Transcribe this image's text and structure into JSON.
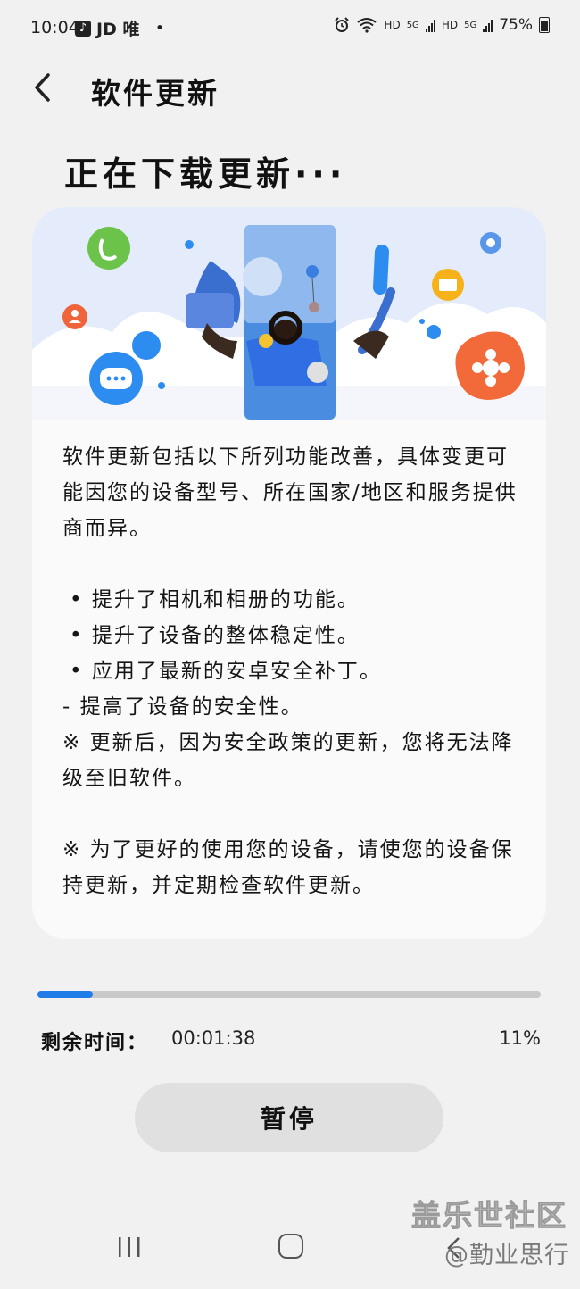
{
  "status_bar": {
    "time": "10:04",
    "left_text": "JD 唯",
    "dot": "•",
    "hd1": "HD",
    "net1": "5G",
    "hd2": "HD",
    "net2": "5G",
    "battery": "75%",
    "icons": [
      "app-icon",
      "alarm-icon",
      "wifi-icon",
      "signal-icon",
      "battery-icon"
    ]
  },
  "header": {
    "title": "软件更新",
    "back_icon": "chevron-left-icon"
  },
  "heading": "正在下载更新···",
  "card": {
    "intro": "软件更新包括以下所列功能改善，具体变更可能因您的设备型号、所在国家/地区和服务提供商而异。",
    "bullets": [
      "•  提升了相机和相册的功能。",
      "•  提升了设备的整体稳定性。",
      "•  应用了最新的安卓安全补丁。"
    ],
    "sub_item": "- 提高了设备的安全性。",
    "note1": "※ 更新后，因为安全政策的更新，您将无法降级至旧软件。",
    "note2": "※ 为了更好的使用您的设备，请使您的设备保持更新，并定期检查软件更新。"
  },
  "progress": {
    "fraction": 0.11,
    "color": "#1f7de8"
  },
  "remaining": {
    "label": "剩余时间：",
    "value": "00:01:38",
    "percent": "11%"
  },
  "pause_label": "暂停",
  "nav": {
    "icons": [
      "recent-apps-icon",
      "home-icon",
      "back-icon"
    ]
  },
  "watermark": {
    "line1": "盖乐世社区",
    "line2": "@勤业思行"
  }
}
